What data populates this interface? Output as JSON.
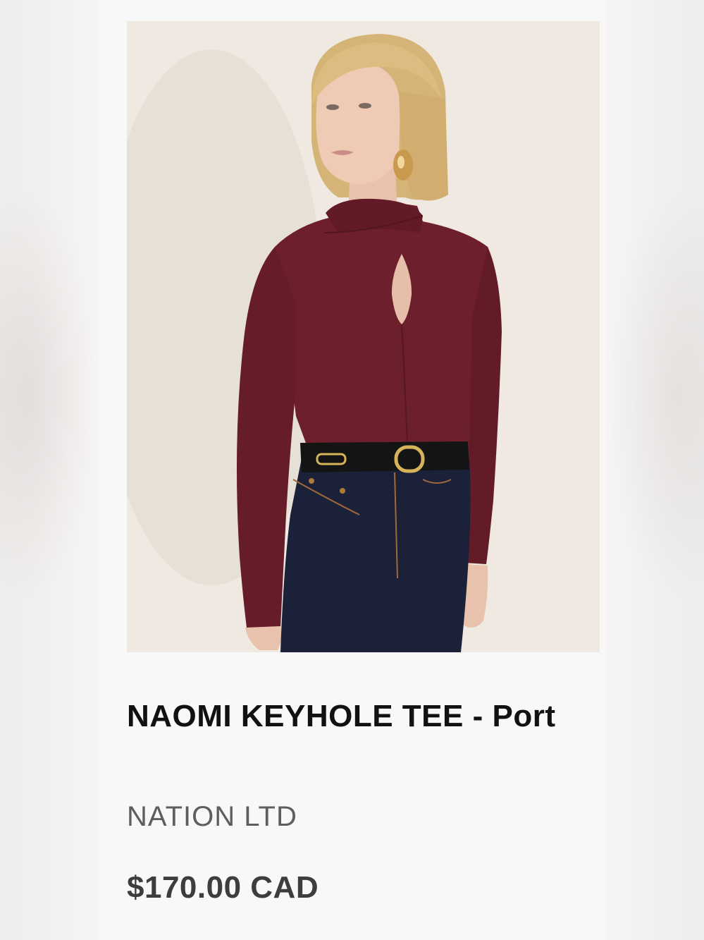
{
  "product": {
    "image_alt": "Model wearing the Naomi Keyhole Tee in Port",
    "title": "NAOMI KEYHOLE TEE - Port",
    "brand": "NATION LTD",
    "price": "$170.00 CAD"
  },
  "colors": {
    "top": "#6e1f2c",
    "denim": "#1a2138",
    "hair": "#d8b779",
    "background": "#efeae4"
  }
}
